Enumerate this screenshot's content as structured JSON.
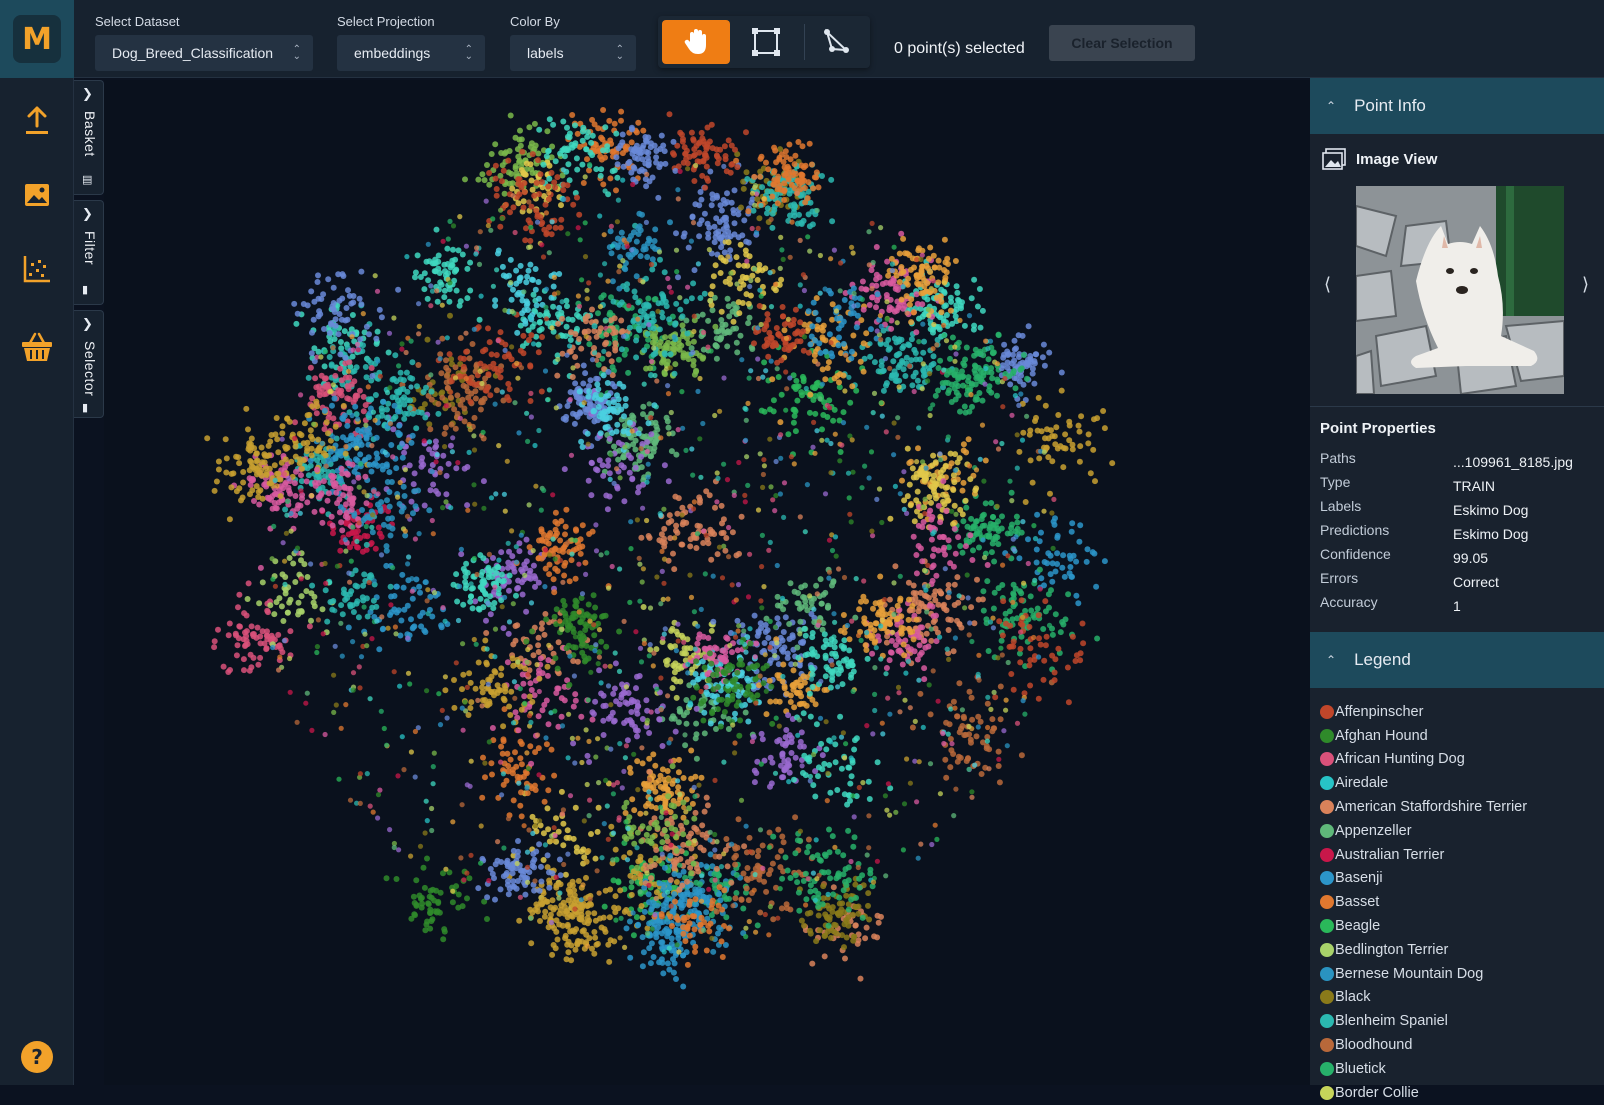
{
  "app": {
    "logo_letter": "M"
  },
  "rail": {
    "items": [
      {
        "name": "upload-icon"
      },
      {
        "name": "image-icon"
      },
      {
        "name": "scatter-plot-icon"
      },
      {
        "name": "basket-icon"
      }
    ],
    "help_label": "?"
  },
  "toolbar": {
    "dataset": {
      "label": "Select Dataset",
      "value": "Dog_Breed_Classification"
    },
    "projection": {
      "label": "Select Projection",
      "value": "embeddings"
    },
    "color_by": {
      "label": "Color By",
      "value": "labels"
    },
    "tools": [
      {
        "name": "pan-hand-icon",
        "active": true
      },
      {
        "name": "box-select-icon",
        "active": false
      },
      {
        "name": "lasso-select-icon",
        "active": false
      }
    ],
    "selection_count": "0 point(s) selected",
    "clear_label": "Clear Selection"
  },
  "side_tabs": [
    {
      "label": "Basket"
    },
    {
      "label": "Filter"
    },
    {
      "label": "Selector"
    }
  ],
  "point_info": {
    "header": "Point Info",
    "image_view_label": "Image View",
    "properties_title": "Point Properties",
    "properties": [
      {
        "key": "Paths",
        "value": "...109961_8185.jpg"
      },
      {
        "key": "Type",
        "value": "TRAIN"
      },
      {
        "key": "Labels",
        "value": "Eskimo Dog"
      },
      {
        "key": "Predictions",
        "value": "Eskimo Dog"
      },
      {
        "key": "Confidence",
        "value": "99.05"
      },
      {
        "key": "Errors",
        "value": "Correct"
      },
      {
        "key": "Accuracy",
        "value": "1"
      }
    ]
  },
  "legend": {
    "header": "Legend",
    "items": [
      {
        "label": "Affenpinscher",
        "color": "#c0462a"
      },
      {
        "label": "Afghan Hound",
        "color": "#2f8a2a"
      },
      {
        "label": "African Hunting Dog",
        "color": "#d9517a"
      },
      {
        "label": "Airedale",
        "color": "#27c3c6"
      },
      {
        "label": "American Staffordshire Terrier",
        "color": "#d9825a"
      },
      {
        "label": "Appenzeller",
        "color": "#5fb87a"
      },
      {
        "label": "Australian Terrier",
        "color": "#c8174a"
      },
      {
        "label": "Basenji",
        "color": "#2c95c9"
      },
      {
        "label": "Basset",
        "color": "#e0782f"
      },
      {
        "label": "Beagle",
        "color": "#2ab85a"
      },
      {
        "label": "Bedlington Terrier",
        "color": "#a8d26a"
      },
      {
        "label": "Bernese Mountain Dog",
        "color": "#2a93c0"
      },
      {
        "label": "Black",
        "color": "#8a7a1a"
      },
      {
        "label": "Blenheim Spaniel",
        "color": "#2bb8b0"
      },
      {
        "label": "Bloodhound",
        "color": "#b8683a"
      },
      {
        "label": "Bluetick",
        "color": "#27b06a"
      },
      {
        "label": "Border Collie",
        "color": "#c6d45a"
      }
    ]
  }
}
